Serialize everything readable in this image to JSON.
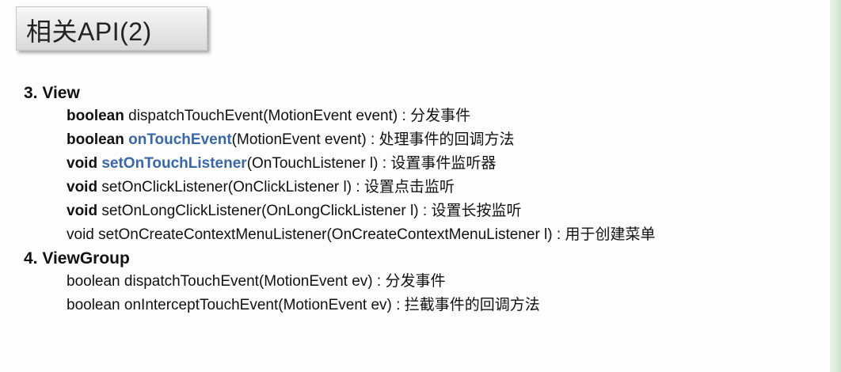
{
  "slide": {
    "title": "相关API(2)"
  },
  "sections": [
    {
      "heading": "3. View",
      "lines": [
        {
          "keyword": "boolean",
          "keyword_bold": true,
          "method": "dispatchTouchEvent",
          "method_highlight": false,
          "params": "(MotionEvent event)",
          "sep": " : ",
          "desc": "分发事件"
        },
        {
          "keyword": "boolean",
          "keyword_bold": true,
          "method": "onTouchEvent",
          "method_highlight": true,
          "params": "(MotionEvent event)",
          "sep": " : ",
          "desc": "处理事件的回调方法"
        },
        {
          "keyword": "void",
          "keyword_bold": true,
          "method": "setOnTouchListener",
          "method_highlight": true,
          "params": "(OnTouchListener l)",
          "sep": " : ",
          "desc": "设置事件监听器"
        },
        {
          "keyword": "void",
          "keyword_bold": true,
          "method": "setOnClickListener",
          "method_highlight": false,
          "params": "(OnClickListener l)",
          "sep": " : ",
          "desc": "设置点击监听"
        },
        {
          "keyword": "void",
          "keyword_bold": true,
          "method": "setOnLongClickListener",
          "method_highlight": false,
          "params": "(OnLongClickListener l)",
          "sep": " : ",
          "desc": "设置长按监听"
        },
        {
          "keyword": "void",
          "keyword_bold": false,
          "method": "setOnCreateContextMenuListener",
          "method_highlight": false,
          "params": "(OnCreateContextMenuListener l)",
          "sep": " : ",
          "desc": "用于创建菜单"
        }
      ]
    },
    {
      "heading": "4. ViewGroup",
      "lines": [
        {
          "keyword": "boolean",
          "keyword_bold": false,
          "method": "dispatchTouchEvent",
          "method_highlight": false,
          "params": "(MotionEvent ev)",
          "sep": " : ",
          "desc": "分发事件"
        },
        {
          "keyword": "boolean",
          "keyword_bold": false,
          "method": "onInterceptTouchEvent",
          "method_highlight": false,
          "params": "(MotionEvent ev)",
          "sep": " : ",
          "desc": "拦截事件的回调方法"
        }
      ]
    }
  ],
  "colors": {
    "highlight": "#3a67a8",
    "text": "#111111",
    "title_box_top": "#f7f7f7",
    "title_box_bottom": "#d9d9d9"
  }
}
